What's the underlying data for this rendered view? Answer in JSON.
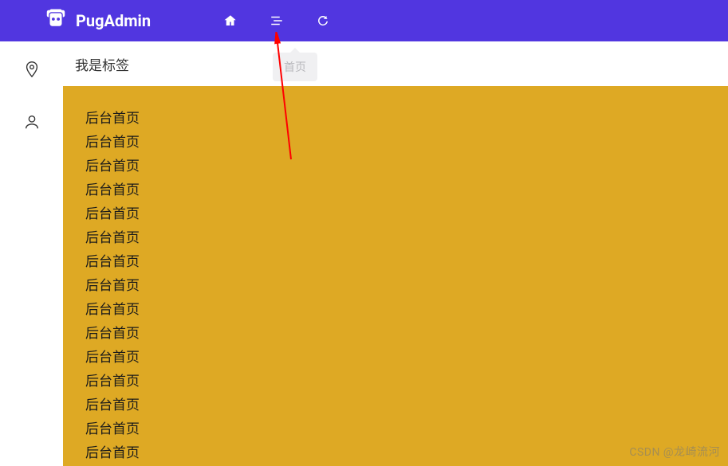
{
  "header": {
    "app_name": "PugAdmin",
    "icons": {
      "home": "home-icon",
      "menu": "menu-icon",
      "refresh": "refresh-icon"
    }
  },
  "sidebar": {
    "items": [
      {
        "icon": "location-icon"
      },
      {
        "icon": "user-icon"
      }
    ]
  },
  "tabbar": {
    "label": "我是标签"
  },
  "tooltip": {
    "text": "首页"
  },
  "content": {
    "lines": [
      "后台首页",
      "后台首页",
      "后台首页",
      "后台首页",
      "后台首页",
      "后台首页",
      "后台首页",
      "后台首页",
      "后台首页",
      "后台首页",
      "后台首页",
      "后台首页",
      "后台首页",
      "后台首页",
      "后台首页"
    ]
  },
  "watermark": "CSDN @龙崎流河",
  "colors": {
    "header_bg": "#5136e0",
    "content_bg": "#dea924",
    "arrow": "#ff0000"
  }
}
